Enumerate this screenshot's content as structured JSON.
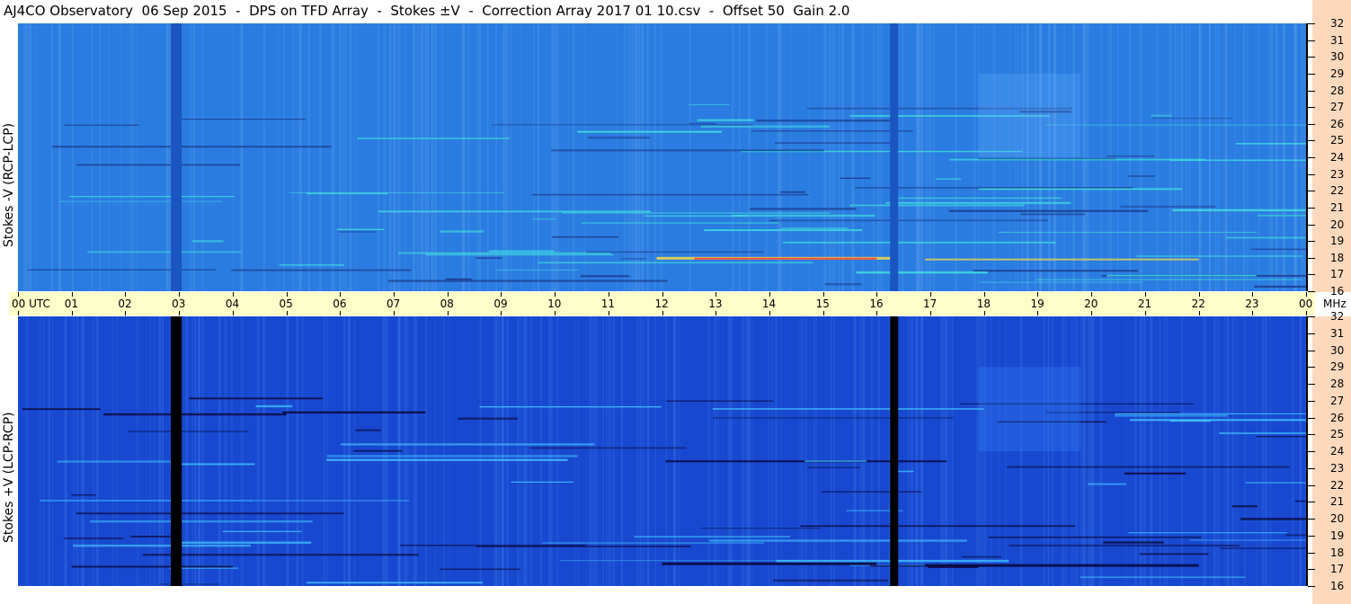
{
  "title": "AJ4CO Observatory  06 Sep 2015  -  DPS on TFD Array  -  Stokes ±V  -  Correction Array 2017 01 10.csv  -  Offset 50  Gain 2.0",
  "chart_data": [
    {
      "type": "heatmap",
      "ylabel": "Stokes -V (RCP-LCP)",
      "x_ticks": [
        "00 UTC",
        "01",
        "02",
        "03",
        "04",
        "05",
        "06",
        "07",
        "08",
        "09",
        "10",
        "11",
        "12",
        "13",
        "14",
        "15",
        "16",
        "17",
        "18",
        "19",
        "20",
        "21",
        "22",
        "23",
        "00"
      ],
      "x_range": [
        0,
        24
      ],
      "y_ticks": [
        "32",
        "31",
        "30",
        "29",
        "28",
        "27",
        "26",
        "25",
        "24",
        "23",
        "22",
        "21",
        "20",
        "19",
        "18",
        "17",
        "16"
      ],
      "y_range": [
        16,
        32
      ],
      "y_unit": "MHz",
      "colors": {
        "background": "#2a7ce0",
        "gap": "#1a55c0",
        "hot": "#ff3030",
        "warm": "#ffe040",
        "cool": "#40e0e0"
      }
    },
    {
      "type": "heatmap",
      "ylabel": "Stokes +V (LCP-RCP)",
      "x_ticks": [
        "00 UTC",
        "01",
        "02",
        "03",
        "04",
        "05",
        "06",
        "07",
        "08",
        "09",
        "10",
        "11",
        "12",
        "13",
        "14",
        "15",
        "16",
        "17",
        "18",
        "19",
        "20",
        "21",
        "22",
        "23",
        "00"
      ],
      "x_range": [
        0,
        24
      ],
      "y_ticks": [
        "32",
        "31",
        "30",
        "29",
        "28",
        "27",
        "26",
        "25",
        "24",
        "23",
        "22",
        "21",
        "20",
        "19",
        "18",
        "17",
        "16"
      ],
      "y_range": [
        16,
        32
      ],
      "y_unit": "MHz",
      "colors": {
        "background": "#1848d0",
        "gap": "#000000",
        "bright": "#40c0ff",
        "dark": "#0a0a40"
      }
    }
  ],
  "axis": {
    "unit_label": "MHz"
  }
}
